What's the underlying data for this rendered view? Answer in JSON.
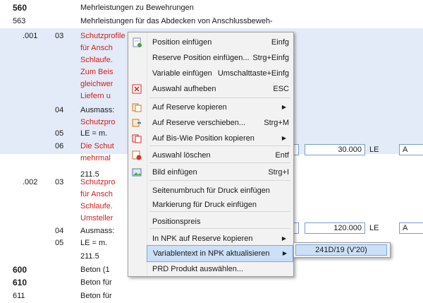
{
  "rows": [
    {
      "c1": "560",
      "c4": "Mehrleistungen zu Bewehrungen",
      "bold": true
    },
    {
      "c1": "563",
      "c4": "Mehrleistungen für das Abdecken von Anschlussbeweh-"
    },
    {
      "c2": ".001",
      "c3": "03",
      "c4": "Schutzprofile aus Kunststoff",
      "red": true
    },
    {
      "c4": "für Ansch",
      "red": true
    },
    {
      "c4": "Schlaufe.",
      "red": true
    },
    {
      "c4": "Zum Beis",
      "red": true
    },
    {
      "c4": "gleichwer",
      "red": true
    },
    {
      "c4": "Liefern u",
      "red": true
    },
    {
      "c3": "04",
      "c4": "Ausmass:"
    },
    {
      "c4": "Schutzpro",
      "red": true
    },
    {
      "c3": "05",
      "c4": "LE = m."
    },
    {
      "c3": "06",
      "c4": "Die Schut",
      "red": true
    },
    {
      "c4": "mehrmal",
      "red": true
    },
    {
      "c4": "211.5"
    },
    {
      "c2": ".002",
      "c3": "03",
      "c4": "Schutzpro",
      "red": true
    },
    {
      "c4": "für Ansch",
      "red": true
    },
    {
      "c4": "Schlaufe.",
      "red": true
    },
    {
      "c4": "Umsteller",
      "red": true
    },
    {
      "c3": "04",
      "c4": "Ausmass:"
    },
    {
      "c3": "05",
      "c4": "LE = m."
    },
    {
      "c4": "211.5"
    },
    {
      "c1": "600",
      "c4": "Beton (1",
      "bold": true
    },
    {
      "c1": "610",
      "c4": "Beton für",
      "bold": true
    },
    {
      "c1": "611",
      "c4": "Beton für"
    }
  ],
  "boxes": {
    "qty1": "30.000",
    "unit1": "LE",
    "code1": "A",
    "qty2": "120.000",
    "unit2": "LE",
    "code2": "A"
  },
  "menu": {
    "items": [
      {
        "label": "Position einfügen",
        "shortcut": "Einfg",
        "icon": "insert-position-icon"
      },
      {
        "label": "Reserve Position einfügen...",
        "shortcut": "Strg+Einfg"
      },
      {
        "label": "Variable einfügen",
        "shortcut": "Umschalttaste+Einfg"
      },
      {
        "label": "Auswahl aufheben",
        "shortcut": "ESC",
        "icon": "cancel-icon"
      },
      {
        "label": "Auf Reserve kopieren",
        "shortcut": "",
        "submenu": true,
        "icon": "copy-reserve-icon"
      },
      {
        "label": "Auf Reserve verschieben...",
        "shortcut": "Strg+M",
        "icon": "move-reserve-icon"
      },
      {
        "label": "Auf Bis-Wie Position kopieren",
        "shortcut": "",
        "submenu": true,
        "icon": "copy-position-icon"
      },
      {
        "label": "Auswahl löschen",
        "shortcut": "Entf",
        "icon": "delete-icon"
      },
      {
        "label": "Bild einfügen",
        "shortcut": "Strg+I",
        "icon": "image-icon"
      },
      {
        "label": "Seitenumbruch für Druck einfügen",
        "shortcut": ""
      },
      {
        "label": "Markierung für Druck einfügen",
        "shortcut": ""
      },
      {
        "label": "Positionspreis",
        "shortcut": ""
      },
      {
        "label": "In NPK auf Reserve kopieren",
        "shortcut": "",
        "submenu": true
      },
      {
        "label": "Variablentext in NPK aktualisieren",
        "shortcut": "",
        "submenu": true,
        "highlight": true
      },
      {
        "label": "PRD Produkt auswählen...",
        "shortcut": ""
      }
    ]
  },
  "submenu": {
    "item": "241D/19 (V'20)"
  },
  "colors": {
    "accent": "#cce0f7",
    "red_text": "#d21c1c",
    "selection": "#e3ebf8"
  }
}
